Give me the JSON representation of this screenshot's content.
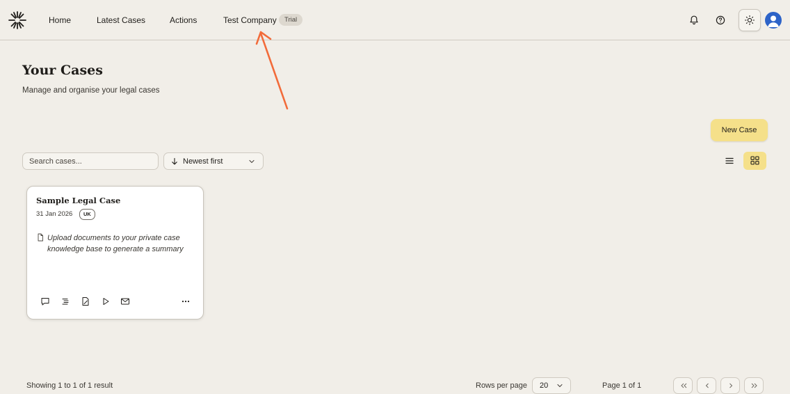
{
  "header": {
    "nav": [
      {
        "label": "Home"
      },
      {
        "label": "Latest Cases"
      },
      {
        "label": "Actions"
      },
      {
        "label": "Test Company"
      }
    ],
    "trial_badge": "Trial"
  },
  "main": {
    "title": "Your Cases",
    "subtitle": "Manage and organise your legal cases",
    "new_case_label": "New Case",
    "search": {
      "placeholder": "Search cases..."
    },
    "sort": {
      "selected": "Newest first"
    },
    "view_mode": "grid"
  },
  "cases": [
    {
      "title": "Sample Legal Case",
      "date": "31 Jan 2026",
      "jurisdiction": "UK",
      "summary": "Upload documents to your private case knowledge base to generate a summary",
      "actions": [
        "chat-icon",
        "outline-icon",
        "draft-icon",
        "play-icon",
        "mail-icon",
        "more-icon"
      ]
    }
  ],
  "footer": {
    "results": "Showing 1 to 1 of 1 result",
    "rows_per_page_label": "Rows per page",
    "rows_per_page": "20",
    "page_info": "Page 1 of 1"
  },
  "colors": {
    "background": "#f1eee8",
    "accent": "#f5e08a",
    "annotation_arrow": "#f26b3a",
    "avatar": "#2d63c8"
  }
}
